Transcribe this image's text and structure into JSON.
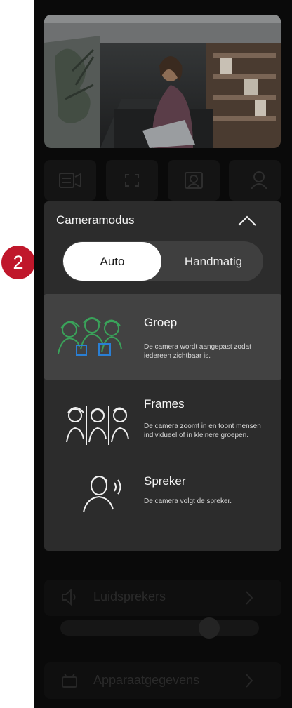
{
  "step_badge": "2",
  "colors": {
    "accent": "#c0172b",
    "panel": "#0a0a0a",
    "sheet": "#2c2c2c",
    "selected": "#424242",
    "green": "#3aa35a",
    "blue": "#2a7fd4"
  },
  "controls": [
    "camera-settings-icon",
    "fullscreen-icon",
    "presenter-frame-icon",
    "person-icon"
  ],
  "camera_mode": {
    "title": "Cameramodus",
    "collapse_icon": "chevron-up-icon",
    "toggle": {
      "selected": "Auto",
      "other": "Handmatig"
    },
    "modes": [
      {
        "id": "groep",
        "title": "Groep",
        "description": "De camera wordt aangepast zodat iedereen zichtbaar is.",
        "selected": true
      },
      {
        "id": "frames",
        "title": "Frames",
        "description": "De camera zoomt in en toont mensen individueel of in kleinere groepen.",
        "selected": false
      },
      {
        "id": "spreker",
        "title": "Spreker",
        "description": "De camera volgt de spreker.",
        "selected": false
      }
    ]
  },
  "speakers": {
    "label": "Luidsprekers",
    "volume_fraction": 0.78
  },
  "device_info": {
    "label": "Apparaatgegevens"
  }
}
